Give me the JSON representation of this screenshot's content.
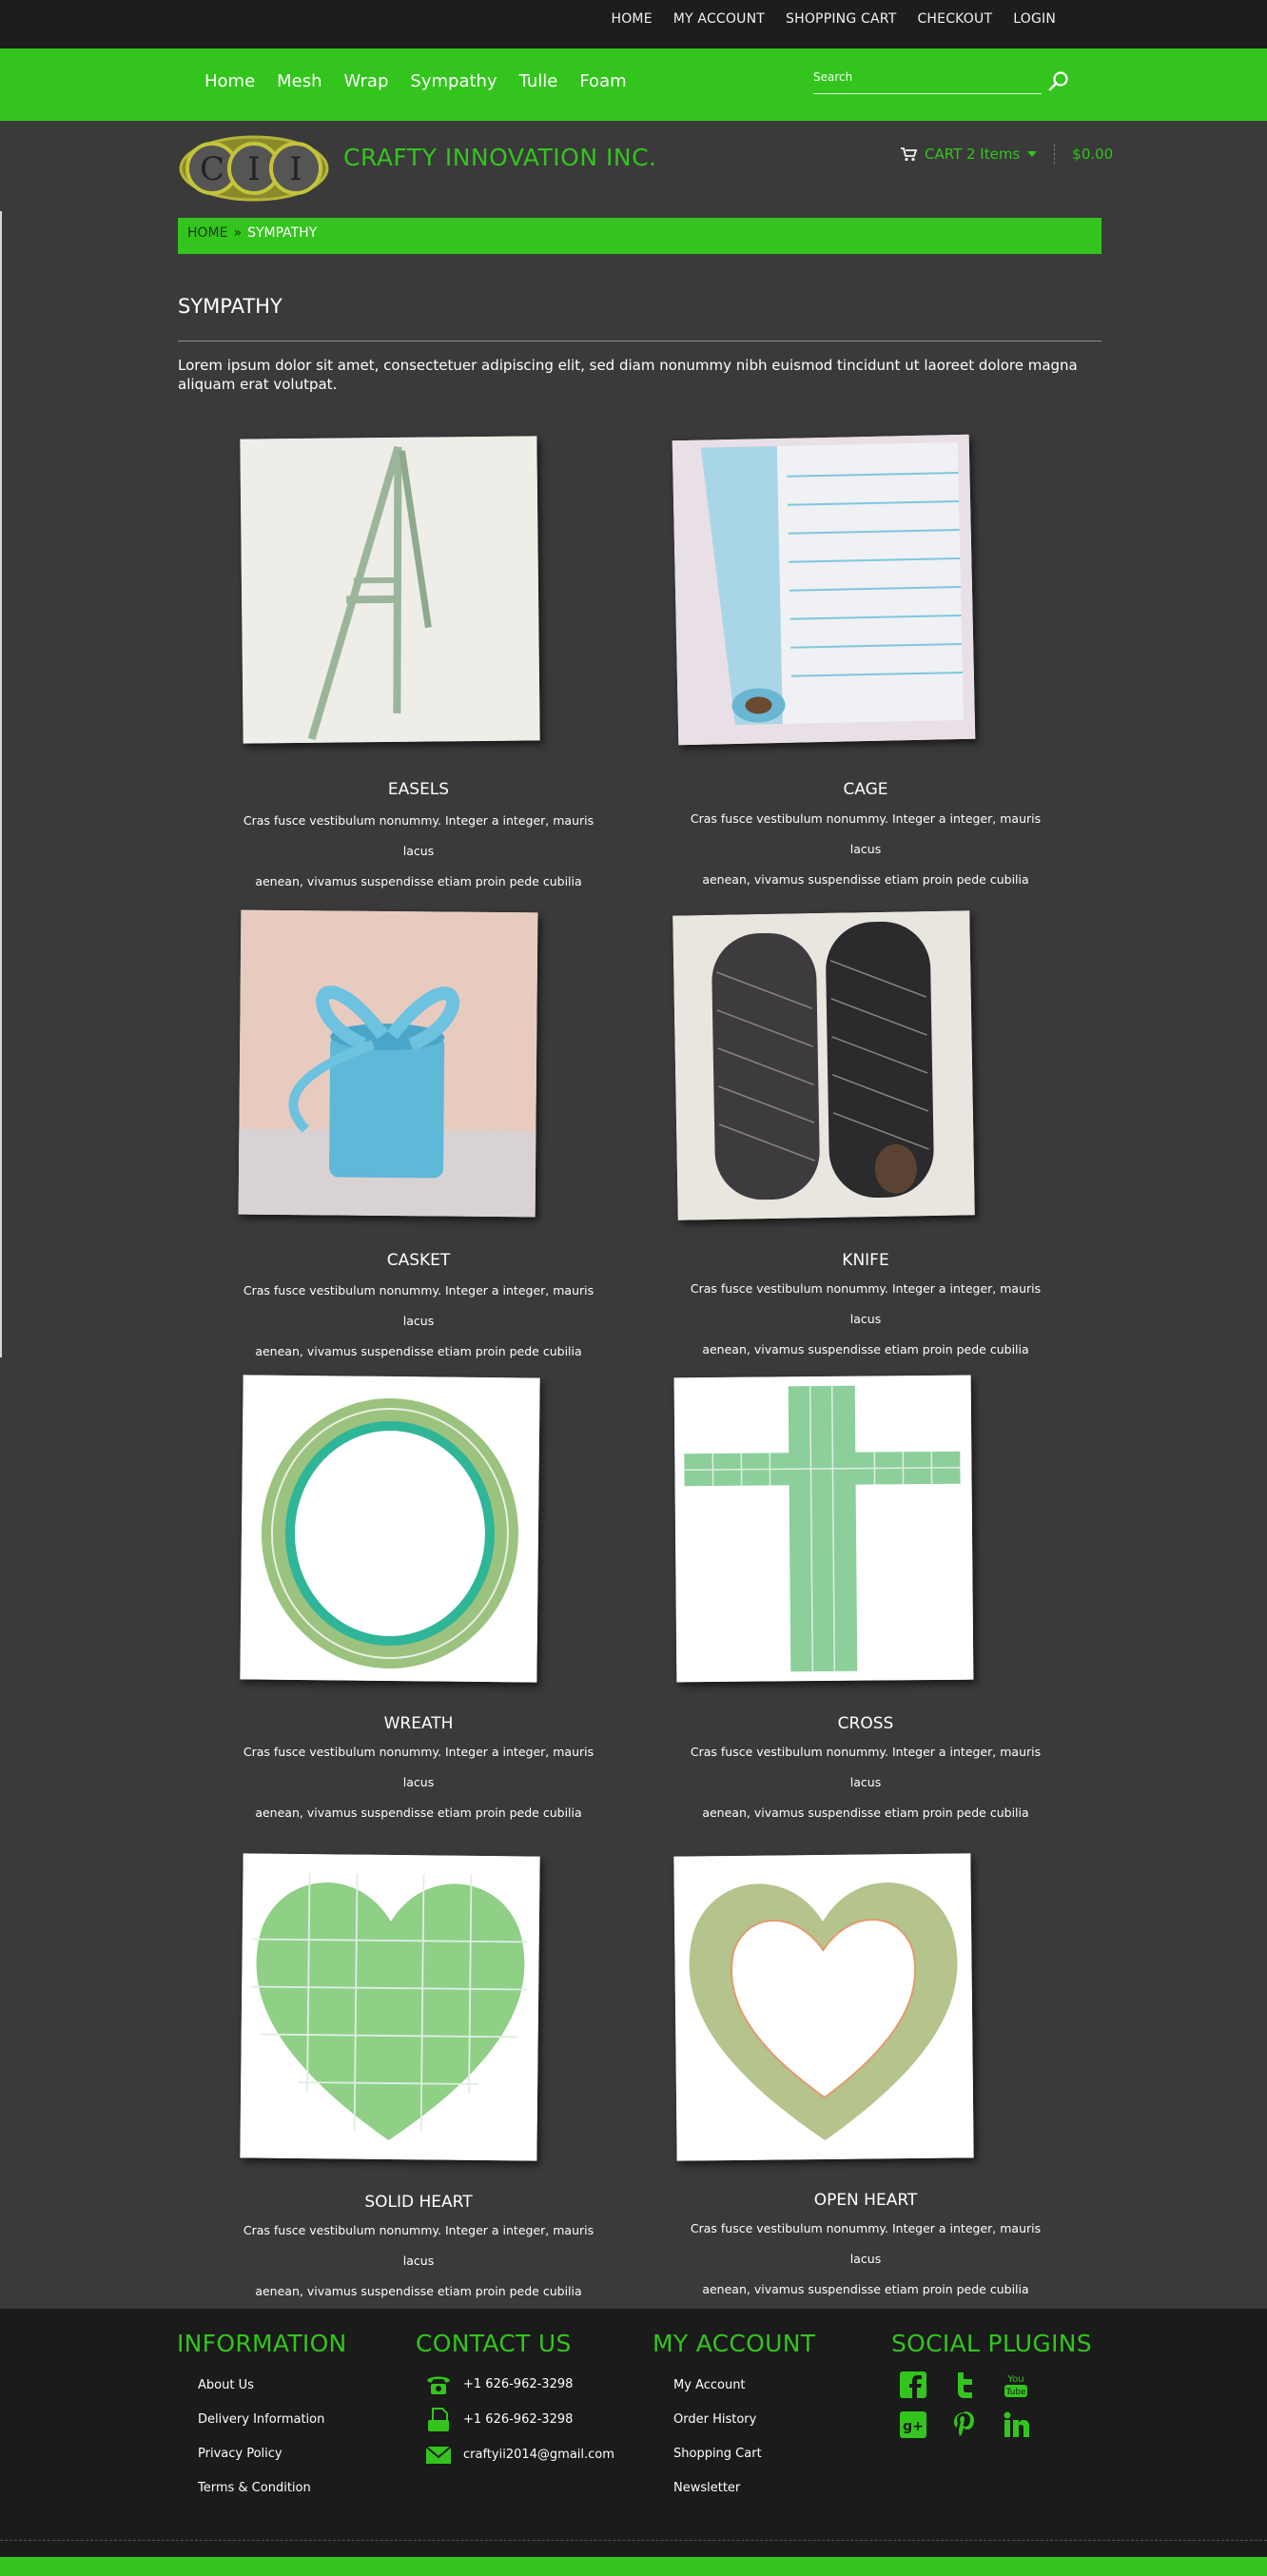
{
  "topbar": {
    "links": [
      "HOME",
      "MY ACCOUNT",
      "SHOPPING CART",
      "CHECKOUT",
      "LOGIN"
    ]
  },
  "nav": {
    "items": [
      "Home",
      "Mesh",
      "Wrap",
      "Sympathy",
      "Tulle",
      "Foam"
    ],
    "search_placeholder": "Search"
  },
  "header": {
    "logo_text": "CII",
    "brand": "CRAFTY INNOVATION INC.",
    "cart_label": "CART 2 Items",
    "cart_total": "$0.00"
  },
  "breadcrumb": {
    "home": "HOME",
    "separator": "»",
    "current": "SYMPATHY"
  },
  "page": {
    "title": "SYMPATHY",
    "intro": "Lorem ipsum dolor sit amet, consectetuer adipiscing elit, sed diam nonummy nibh euismod tincidunt ut laoreet dolore magna aliquam erat volutpat."
  },
  "products": [
    {
      "name": "EASELS",
      "desc_line1": "Cras fusce vestibulum nonummy. Integer a integer, mauris lacus",
      "desc_line2": "aenean, vivamus suspendisse etiam proin pede cubilia"
    },
    {
      "name": "CAGE",
      "desc_line1": "Cras fusce vestibulum nonummy. Integer a integer, mauris lacus",
      "desc_line2": "aenean, vivamus suspendisse etiam proin pede cubilia"
    },
    {
      "name": "CASKET",
      "desc_line1": "Cras fusce vestibulum nonummy. Integer a integer, mauris lacus",
      "desc_line2": "aenean, vivamus suspendisse etiam proin pede cubilia"
    },
    {
      "name": "KNIFE",
      "desc_line1": "Cras fusce vestibulum nonummy. Integer a integer, mauris lacus",
      "desc_line2": "aenean, vivamus suspendisse etiam proin pede cubilia"
    },
    {
      "name": "WREATH",
      "desc_line1": "Cras fusce vestibulum nonummy. Integer a integer, mauris lacus",
      "desc_line2": "aenean, vivamus suspendisse etiam proin pede cubilia"
    },
    {
      "name": "CROSS",
      "desc_line1": "Cras fusce vestibulum nonummy. Integer a integer, mauris lacus",
      "desc_line2": "aenean, vivamus suspendisse etiam proin pede cubilia"
    },
    {
      "name": "SOLID HEART",
      "desc_line1": "Cras fusce vestibulum nonummy. Integer a integer, mauris lacus",
      "desc_line2": "aenean, vivamus suspendisse etiam proin pede cubilia"
    },
    {
      "name": "OPEN HEART",
      "desc_line1": "Cras fusce vestibulum nonummy. Integer a integer, mauris lacus",
      "desc_line2": "aenean, vivamus suspendisse etiam proin pede cubilia"
    }
  ],
  "footer": {
    "information": {
      "title": "INFORMATION",
      "items": [
        "About Us",
        "Delivery Information",
        "Privacy Policy",
        "Terms & Condition"
      ]
    },
    "contact": {
      "title": "CONTACT US",
      "phone": "+1 626-962-3298",
      "fax": "+1 626-962-3298",
      "email": "craftyii2014@gmail.com"
    },
    "account": {
      "title": "MY ACCOUNT",
      "items": [
        "My Account",
        "Order History",
        "Shopping Cart",
        "Newsletter"
      ]
    },
    "social": {
      "title": "SOCIAL PLUGINS",
      "icons": [
        "facebook-icon",
        "twitter-icon",
        "youtube-icon",
        "google-plus-icon",
        "pinterest-icon",
        "linkedin-icon"
      ]
    }
  },
  "colors": {
    "accent": "#33c51d",
    "background": "#3a3a3a",
    "topbar": "#1d1d1d",
    "footer": "#1b1b1b"
  }
}
